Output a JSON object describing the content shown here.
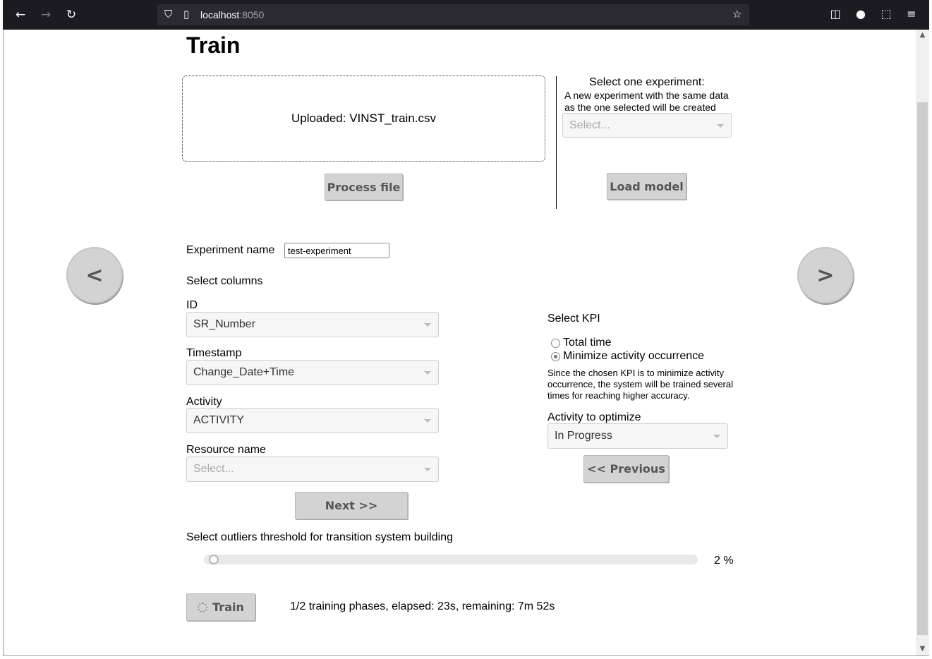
{
  "browser": {
    "url_host": "localhost",
    "url_port": ":8050"
  },
  "page": {
    "title": "Train",
    "upload": {
      "text": "Uploaded: VINST_train.csv"
    },
    "process_button": "Process file",
    "experiment_select": {
      "title": "Select one experiment:",
      "subtitle": "A new experiment with the same data as the one selected will be created",
      "placeholder": "Select..."
    },
    "load_model_button": "Load model",
    "nav": {
      "prev": "<",
      "next": ">"
    },
    "experiment_name": {
      "label": "Experiment name",
      "value": "test-experiment"
    },
    "select_columns_label": "Select columns",
    "columns": {
      "id": {
        "label": "ID",
        "value": "SR_Number"
      },
      "timestamp": {
        "label": "Timestamp",
        "value": "Change_Date+Time"
      },
      "activity": {
        "label": "Activity",
        "value": "ACTIVITY"
      },
      "resource": {
        "label": "Resource name",
        "placeholder": "Select..."
      }
    },
    "next_button": "Next >>",
    "kpi": {
      "label": "Select KPI",
      "options": [
        "Total time",
        "Minimize activity occurrence"
      ],
      "selected": "Minimize activity occurrence",
      "note": "Since the chosen KPI is to minimize activity occurrence, the system will be trained several times for reaching higher accuracy.",
      "activity_label": "Activity to optimize",
      "activity_value": "In Progress"
    },
    "previous_button": "<< Previous",
    "threshold": {
      "label": "Select outliers threshold for transition system building",
      "value": 2,
      "value_text": "2 %"
    },
    "train_button": "Train",
    "status": "1/2 training phases, elapsed: 23s, remaining: 7m 52s"
  }
}
